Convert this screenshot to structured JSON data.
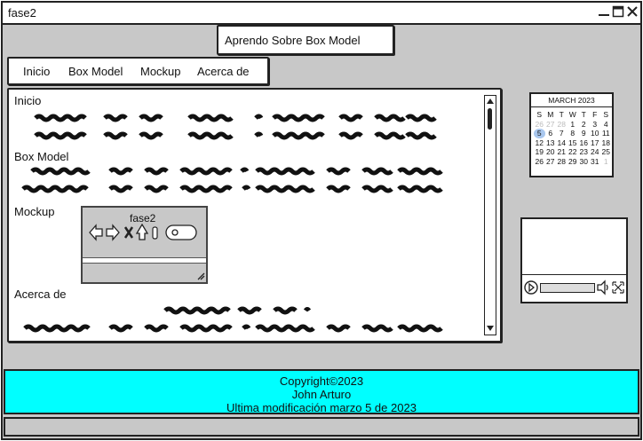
{
  "window": {
    "title": "fase2"
  },
  "header": {
    "title": "Aprendo Sobre Box Model"
  },
  "nav": {
    "items": [
      "Inicio",
      "Box Model",
      "Mockup",
      "Acerca de"
    ]
  },
  "sections": {
    "inicio": "Inicio",
    "box_model": "Box Model",
    "mockup": "Mockup",
    "acerca": "Acerca de"
  },
  "mockup_preview": {
    "title": "fase2"
  },
  "calendar": {
    "month": "MARCH 2023",
    "weekdays": [
      "S",
      "M",
      "T",
      "W",
      "T",
      "F",
      "S"
    ],
    "weeks": [
      [
        "26",
        "27",
        "28",
        "1",
        "2",
        "3",
        "4"
      ],
      [
        "5",
        "6",
        "7",
        "8",
        "9",
        "10",
        "11"
      ],
      [
        "12",
        "13",
        "14",
        "15",
        "16",
        "17",
        "18"
      ],
      [
        "19",
        "20",
        "21",
        "22",
        "23",
        "24",
        "25"
      ],
      [
        "26",
        "27",
        "28",
        "29",
        "30",
        "31",
        "1"
      ]
    ],
    "selected_day": "5"
  },
  "footer": {
    "line1": "Copyright©2023",
    "line2": "John Arturo",
    "line3": "Ultima modificación marzo 5 de 2023"
  },
  "colors": {
    "footer_bg": "#00ffff",
    "window_bg": "#c8c8c8",
    "border": "#222222"
  }
}
